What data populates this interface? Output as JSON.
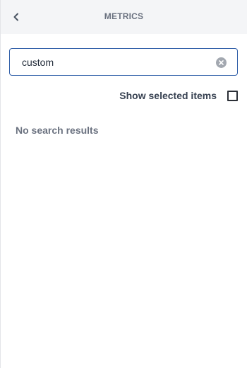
{
  "header": {
    "title": "METRICS",
    "back_icon": "chevron-left-icon"
  },
  "search": {
    "value": "custom",
    "placeholder": "",
    "clear_icon": "clear-circle-icon"
  },
  "filter": {
    "show_selected_label": "Show selected items",
    "show_selected_checked": false
  },
  "results": {
    "empty_message": "No search results"
  },
  "colors": {
    "header_bg": "#f4f5f7",
    "accent_border": "#2f5ea8",
    "muted_text": "#6b7280"
  }
}
